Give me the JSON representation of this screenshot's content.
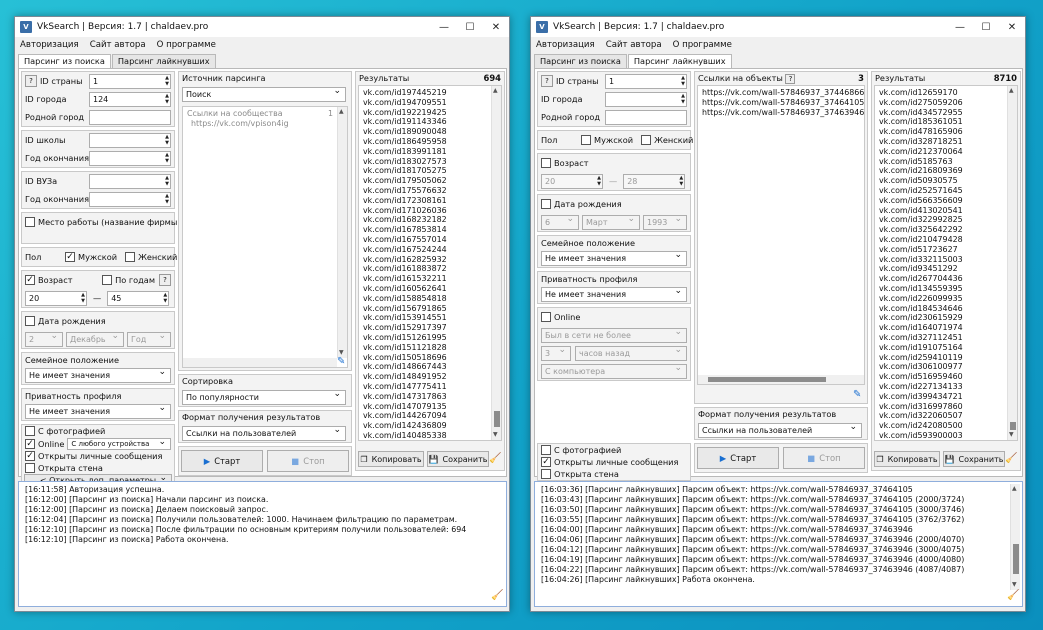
{
  "colors": {
    "accent": "#1a6fd1",
    "bg": "#f0f0f0"
  },
  "left": {
    "title": "VkSearch | Версия: 1.7 | chaldaev.pro",
    "menu": [
      "Авторизация",
      "Сайт автора",
      "О программе"
    ],
    "tabs": [
      "Парсинг из поиска",
      "Парсинг лайкнувших"
    ],
    "fields": {
      "country_label": "ID страны",
      "country_value": "1",
      "city_label": "ID города",
      "city_value": "124",
      "hometown_label": "Родной город",
      "school_label": "ID школы",
      "school_grad_label": "Год окончания",
      "univ_label": "ID ВУЗа",
      "univ_grad_label": "Год окончания",
      "work_label": "Место работы (название фирмы)",
      "sex_label": "Пол",
      "male_label": "Мужской",
      "female_label": "Женский",
      "age_label": "Возраст",
      "by_years_label": "По годам",
      "age_from": "20",
      "age_dash": "—",
      "age_to": "45",
      "birth_label": "Дата рождения",
      "birth_day": "2",
      "birth_month": "Декабрь",
      "birth_year": "Год",
      "family_label": "Семейное положение",
      "family_value": "Не имеет значения",
      "privacy_label": "Приватность профиля",
      "privacy_value": "Не имеет значения",
      "photo_label": "С фотографией",
      "online_label": "Online",
      "online_value": "С любого устройства",
      "open_msg_label": "Открыты личные сообщения",
      "open_wall_label": "Открыта стена",
      "more_params": "< Открыть доп. параметры",
      "q": "?"
    },
    "source": {
      "label": "Источник парсинга",
      "value": "Поиск",
      "links_label": "Ссылки на сообщества",
      "links_count": "1",
      "link": "https://vk.com/vpison4ig"
    },
    "sort": {
      "label": "Сортировка",
      "value": "По популярности"
    },
    "format": {
      "label": "Формат получения результатов",
      "value": "Ссылки на пользователей"
    },
    "buttons": {
      "start": "Старт",
      "stop": "Стоп",
      "copy": "Копировать",
      "save": "Сохранить"
    },
    "results": {
      "label": "Результаты",
      "count": "694",
      "items": [
        "vk.com/id197445219",
        "vk.com/id194709551",
        "vk.com/id192219425",
        "vk.com/id191143346",
        "vk.com/id189090048",
        "vk.com/id186495958",
        "vk.com/id183991181",
        "vk.com/id183027573",
        "vk.com/id181705275",
        "vk.com/id179505062",
        "vk.com/id175576632",
        "vk.com/id172308161",
        "vk.com/id171026036",
        "vk.com/id168232182",
        "vk.com/id167853814",
        "vk.com/id167557014",
        "vk.com/id167524244",
        "vk.com/id162825932",
        "vk.com/id161883872",
        "vk.com/id161532211",
        "vk.com/id160562641",
        "vk.com/id158854818",
        "vk.com/id156791865",
        "vk.com/id153914551",
        "vk.com/id152917397",
        "vk.com/id151261995",
        "vk.com/id151121828",
        "vk.com/id150518696",
        "vk.com/id148667443",
        "vk.com/id148491952",
        "vk.com/id147775411",
        "vk.com/id147317863",
        "vk.com/id147079135",
        "vk.com/id144267094",
        "vk.com/id142436809",
        "vk.com/id140485338"
      ]
    },
    "log": [
      "[16:11:58] Авторизация успешна.",
      "[16:12:00] [Парсинг из поиска] Начали парсинг из поиска.",
      "[16:12:00] [Парсинг из поиска] Делаем поисковый запрос.",
      "[16:12:04] [Парсинг из поиска] Получили пользователей: 1000. Начинаем фильтрацию по параметрам.",
      "[16:12:10] [Парсинг из поиска] После фильтрации по основным критериям получили пользователей: 694",
      "[16:12:10] [Парсинг из поиска] Работа окончена."
    ]
  },
  "right": {
    "title": "VkSearch | Версия: 1.7 | chaldaev.pro",
    "menu": [
      "Авторизация",
      "Сайт автора",
      "О программе"
    ],
    "tabs": [
      "Парсинг из поиска",
      "Парсинг лайкнувших"
    ],
    "fields": {
      "country_label": "ID страны",
      "country_value": "1",
      "city_label": "ID города",
      "hometown_label": "Родной город",
      "sex_label": "Пол",
      "male_label": "Мужской",
      "female_label": "Женский",
      "age_label": "Возраст",
      "age_from": "20",
      "age_dash": "—",
      "age_to": "28",
      "birth_label": "Дата рождения",
      "birth_day": "6",
      "birth_month": "Март",
      "birth_year": "1993",
      "family_label": "Семейное положение",
      "family_value": "Не имеет значения",
      "privacy_label": "Приватность профиля",
      "privacy_value": "Не имеет значения",
      "online_label": "Online",
      "last_seen": "Был в сети не более",
      "hours_val": "3",
      "hours_unit": "часов назад",
      "device": "С компьютера",
      "photo_label": "С фотографией",
      "open_msg_label": "Открыты личные сообщения",
      "open_wall_label": "Открыта стена",
      "q": "?"
    },
    "objects": {
      "label": "Ссылки на объекты",
      "count": "3",
      "items": [
        "https://vk.com/wall-57846937_37446866",
        "https://vk.com/wall-57846937_37464105",
        "https://vk.com/wall-57846937_37463946"
      ]
    },
    "format": {
      "label": "Формат получения результатов",
      "value": "Ссылки на пользователей"
    },
    "buttons": {
      "start": "Старт",
      "stop": "Стоп",
      "copy": "Копировать",
      "save": "Сохранить"
    },
    "results": {
      "label": "Результаты",
      "count": "8710",
      "items": [
        "vk.com/id12659170",
        "vk.com/id275059206",
        "vk.com/id434572955",
        "vk.com/id185361051",
        "vk.com/id478165906",
        "vk.com/id328718251",
        "vk.com/id212370064",
        "vk.com/id5185763",
        "vk.com/id216809369",
        "vk.com/id50930575",
        "vk.com/id252571645",
        "vk.com/id566356609",
        "vk.com/id413020541",
        "vk.com/id322992825",
        "vk.com/id325642292",
        "vk.com/id210479428",
        "vk.com/id51723627",
        "vk.com/id332115003",
        "vk.com/id93451292",
        "vk.com/id267704436",
        "vk.com/id134559395",
        "vk.com/id226099935",
        "vk.com/id184534646",
        "vk.com/id230615929",
        "vk.com/id164071974",
        "vk.com/id327112451",
        "vk.com/id191075164",
        "vk.com/id259410119",
        "vk.com/id306100977",
        "vk.com/id516959460",
        "vk.com/id227134133",
        "vk.com/id399434721",
        "vk.com/id316997860",
        "vk.com/id322060507",
        "vk.com/id242080500",
        "vk.com/id593900003"
      ]
    },
    "log": [
      "[16:03:36] [Парсинг лайкнувших] Парсим объект: https://vk.com/wall-57846937_37464105",
      "[16:03:43] [Парсинг лайкнувших] Парсим объект: https://vk.com/wall-57846937_37464105 (2000/3724)",
      "[16:03:50] [Парсинг лайкнувших] Парсим объект: https://vk.com/wall-57846937_37464105 (3000/3746)",
      "[16:03:55] [Парсинг лайкнувших] Парсим объект: https://vk.com/wall-57846937_37464105 (3762/3762)",
      "[16:04:00] [Парсинг лайкнувших] Парсим объект: https://vk.com/wall-57846937_37463946",
      "[16:04:06] [Парсинг лайкнувших] Парсим объект: https://vk.com/wall-57846937_37463946 (2000/4070)",
      "[16:04:12] [Парсинг лайкнувших] Парсим объект: https://vk.com/wall-57846937_37463946 (3000/4075)",
      "[16:04:19] [Парсинг лайкнувших] Парсим объект: https://vk.com/wall-57846937_37463946 (4000/4080)",
      "[16:04:22] [Парсинг лайкнувших] Парсим объект: https://vk.com/wall-57846937_37463946 (4087/4087)",
      "[16:04:26] [Парсинг лайкнувших] Работа окончена."
    ]
  }
}
